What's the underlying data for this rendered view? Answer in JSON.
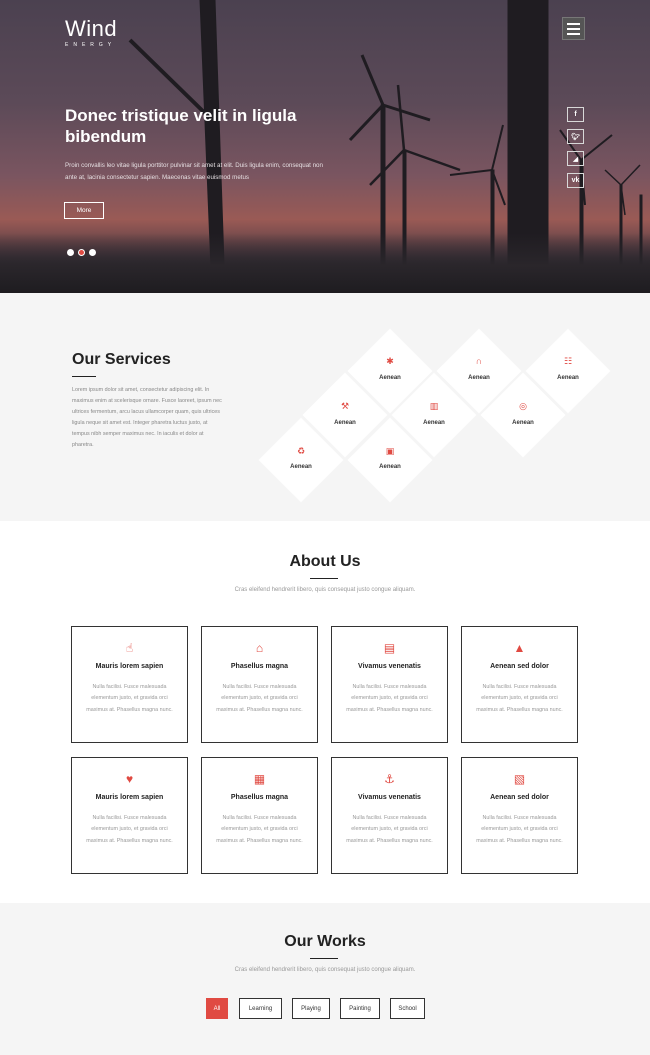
{
  "brand": {
    "name": "Wind",
    "tagline": "ENERGY"
  },
  "hero": {
    "title": "Donec tristique velit in ligula bibendum",
    "text": "Proin convallis leo vitae ligula porttitor pulvinar sit amet at elit. Duis ligula enim, consequat non ante at, lacinia consectetur sapien. Maecenas vitae euismod metus",
    "more_label": "More",
    "slides": 3,
    "active_slide": 2
  },
  "social": [
    "f",
    "t",
    "rss",
    "vk"
  ],
  "services": {
    "title": "Our Services",
    "text": "Lorem ipsum dolor sit amet, consectetur adipiscing elit. In maximus enim at scelerisque ornare. Fusce laoreet, ipsum nec ultrices fermentum, arcu lacus ullamcorper quam, quis ultrices ligula neque sit amet est. Integer pharetra luctus justo, at tempus nibh semper maximus nec. In iaculis et dolor at pharetra.",
    "tiles": [
      {
        "label": "Aenean",
        "icon": "asterisk-icon"
      },
      {
        "label": "Aenean",
        "icon": "magnet-icon"
      },
      {
        "label": "Aenean",
        "icon": "sitemap-icon"
      },
      {
        "label": "Aenean",
        "icon": "gavel-icon"
      },
      {
        "label": "Aenean",
        "icon": "map-icon"
      },
      {
        "label": "Aenean",
        "icon": "life-ring-icon"
      },
      {
        "label": "Aenean",
        "icon": "recycle-icon"
      },
      {
        "label": "Aenean",
        "icon": "money-icon"
      }
    ]
  },
  "about": {
    "title": "About Us",
    "subtitle": "Cras eleifend hendrerit libero, quis consequat justo congue aliquam.",
    "cards": [
      {
        "title": "Mauris lorem sapien",
        "icon": "thumbs-up-icon",
        "text": "Nulla facilisi. Fusce malesuada elementum justo, et gravida orci maximus at. Phasellus magna nunc."
      },
      {
        "title": "Phasellus magna",
        "icon": "bank-icon",
        "text": "Nulla facilisi. Fusce malesuada elementum justo, et gravida orci maximus at. Phasellus magna nunc."
      },
      {
        "title": "Vivamus venenatis",
        "icon": "briefcase-icon",
        "text": "Nulla facilisi. Fusce malesuada elementum justo, et gravida orci maximus at. Phasellus magna nunc."
      },
      {
        "title": "Aenean sed dolor",
        "icon": "road-icon",
        "text": "Nulla facilisi. Fusce malesuada elementum justo, et gravida orci maximus at. Phasellus magna nunc."
      },
      {
        "title": "Mauris lorem sapien",
        "icon": "heart-icon",
        "text": "Nulla facilisi. Fusce malesuada elementum justo, et gravida orci maximus at. Phasellus magna nunc."
      },
      {
        "title": "Phasellus magna",
        "icon": "gift-icon",
        "text": "Nulla facilisi. Fusce malesuada elementum justo, et gravida orci maximus at. Phasellus magna nunc."
      },
      {
        "title": "Vivamus venenatis",
        "icon": "anchor-icon",
        "text": "Nulla facilisi. Fusce malesuada elementum justo, et gravida orci maximus at. Phasellus magna nunc."
      },
      {
        "title": "Aenean sed dolor",
        "icon": "archive-icon",
        "text": "Nulla facilisi. Fusce malesuada elementum justo, et gravida orci maximus at. Phasellus magna nunc."
      }
    ]
  },
  "works": {
    "title": "Our Works",
    "subtitle": "Cras eleifend hendrerit libero, quis consequat justo congue aliquam.",
    "filters": [
      "All",
      "Learning",
      "Playing",
      "Painting",
      "School"
    ],
    "active_filter": "All"
  },
  "colors": {
    "accent": "#e04a42",
    "dark": "#222222",
    "light_bg": "#f5f5f5"
  }
}
